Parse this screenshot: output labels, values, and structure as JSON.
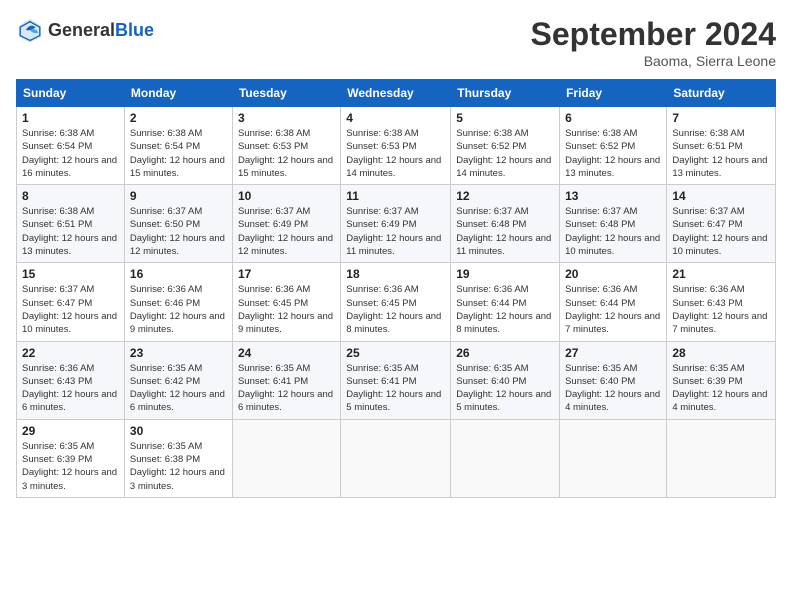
{
  "header": {
    "logo_general": "General",
    "logo_blue": "Blue",
    "month_title": "September 2024",
    "location": "Baoma, Sierra Leone"
  },
  "weekdays": [
    "Sunday",
    "Monday",
    "Tuesday",
    "Wednesday",
    "Thursday",
    "Friday",
    "Saturday"
  ],
  "weeks": [
    [
      {
        "day": "1",
        "sunrise": "6:38 AM",
        "sunset": "6:54 PM",
        "daylight": "Daylight: 12 hours and 16 minutes."
      },
      {
        "day": "2",
        "sunrise": "6:38 AM",
        "sunset": "6:54 PM",
        "daylight": "Daylight: 12 hours and 15 minutes."
      },
      {
        "day": "3",
        "sunrise": "6:38 AM",
        "sunset": "6:53 PM",
        "daylight": "Daylight: 12 hours and 15 minutes."
      },
      {
        "day": "4",
        "sunrise": "6:38 AM",
        "sunset": "6:53 PM",
        "daylight": "Daylight: 12 hours and 14 minutes."
      },
      {
        "day": "5",
        "sunrise": "6:38 AM",
        "sunset": "6:52 PM",
        "daylight": "Daylight: 12 hours and 14 minutes."
      },
      {
        "day": "6",
        "sunrise": "6:38 AM",
        "sunset": "6:52 PM",
        "daylight": "Daylight: 12 hours and 13 minutes."
      },
      {
        "day": "7",
        "sunrise": "6:38 AM",
        "sunset": "6:51 PM",
        "daylight": "Daylight: 12 hours and 13 minutes."
      }
    ],
    [
      {
        "day": "8",
        "sunrise": "6:38 AM",
        "sunset": "6:51 PM",
        "daylight": "Daylight: 12 hours and 13 minutes."
      },
      {
        "day": "9",
        "sunrise": "6:37 AM",
        "sunset": "6:50 PM",
        "daylight": "Daylight: 12 hours and 12 minutes."
      },
      {
        "day": "10",
        "sunrise": "6:37 AM",
        "sunset": "6:49 PM",
        "daylight": "Daylight: 12 hours and 12 minutes."
      },
      {
        "day": "11",
        "sunrise": "6:37 AM",
        "sunset": "6:49 PM",
        "daylight": "Daylight: 12 hours and 11 minutes."
      },
      {
        "day": "12",
        "sunrise": "6:37 AM",
        "sunset": "6:48 PM",
        "daylight": "Daylight: 12 hours and 11 minutes."
      },
      {
        "day": "13",
        "sunrise": "6:37 AM",
        "sunset": "6:48 PM",
        "daylight": "Daylight: 12 hours and 10 minutes."
      },
      {
        "day": "14",
        "sunrise": "6:37 AM",
        "sunset": "6:47 PM",
        "daylight": "Daylight: 12 hours and 10 minutes."
      }
    ],
    [
      {
        "day": "15",
        "sunrise": "6:37 AM",
        "sunset": "6:47 PM",
        "daylight": "Daylight: 12 hours and 10 minutes."
      },
      {
        "day": "16",
        "sunrise": "6:36 AM",
        "sunset": "6:46 PM",
        "daylight": "Daylight: 12 hours and 9 minutes."
      },
      {
        "day": "17",
        "sunrise": "6:36 AM",
        "sunset": "6:45 PM",
        "daylight": "Daylight: 12 hours and 9 minutes."
      },
      {
        "day": "18",
        "sunrise": "6:36 AM",
        "sunset": "6:45 PM",
        "daylight": "Daylight: 12 hours and 8 minutes."
      },
      {
        "day": "19",
        "sunrise": "6:36 AM",
        "sunset": "6:44 PM",
        "daylight": "Daylight: 12 hours and 8 minutes."
      },
      {
        "day": "20",
        "sunrise": "6:36 AM",
        "sunset": "6:44 PM",
        "daylight": "Daylight: 12 hours and 7 minutes."
      },
      {
        "day": "21",
        "sunrise": "6:36 AM",
        "sunset": "6:43 PM",
        "daylight": "Daylight: 12 hours and 7 minutes."
      }
    ],
    [
      {
        "day": "22",
        "sunrise": "6:36 AM",
        "sunset": "6:43 PM",
        "daylight": "Daylight: 12 hours and 6 minutes."
      },
      {
        "day": "23",
        "sunrise": "6:35 AM",
        "sunset": "6:42 PM",
        "daylight": "Daylight: 12 hours and 6 minutes."
      },
      {
        "day": "24",
        "sunrise": "6:35 AM",
        "sunset": "6:41 PM",
        "daylight": "Daylight: 12 hours and 6 minutes."
      },
      {
        "day": "25",
        "sunrise": "6:35 AM",
        "sunset": "6:41 PM",
        "daylight": "Daylight: 12 hours and 5 minutes."
      },
      {
        "day": "26",
        "sunrise": "6:35 AM",
        "sunset": "6:40 PM",
        "daylight": "Daylight: 12 hours and 5 minutes."
      },
      {
        "day": "27",
        "sunrise": "6:35 AM",
        "sunset": "6:40 PM",
        "daylight": "Daylight: 12 hours and 4 minutes."
      },
      {
        "day": "28",
        "sunrise": "6:35 AM",
        "sunset": "6:39 PM",
        "daylight": "Daylight: 12 hours and 4 minutes."
      }
    ],
    [
      {
        "day": "29",
        "sunrise": "6:35 AM",
        "sunset": "6:39 PM",
        "daylight": "Daylight: 12 hours and 3 minutes."
      },
      {
        "day": "30",
        "sunrise": "6:35 AM",
        "sunset": "6:38 PM",
        "daylight": "Daylight: 12 hours and 3 minutes."
      },
      null,
      null,
      null,
      null,
      null
    ]
  ]
}
